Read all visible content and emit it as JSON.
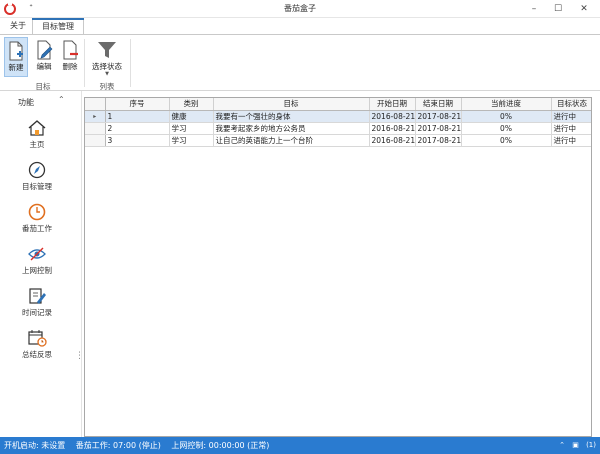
{
  "window": {
    "title": "番茄盒子",
    "quick_access": "ᐩ",
    "minimize": "–",
    "maximize": "☐",
    "close": "✕"
  },
  "ribbon": {
    "tabs": [
      "关于",
      "目标管理"
    ],
    "buttons": {
      "new": "新建",
      "edit": "编辑",
      "delete": "删除",
      "filter": "选择状态"
    },
    "groups": {
      "goal": "目标",
      "list": "列表"
    }
  },
  "nav": {
    "header": "功能",
    "collapse": "⌃",
    "items": [
      {
        "label": "主页",
        "icon": "home-icon"
      },
      {
        "label": "目标管理",
        "icon": "compass-icon"
      },
      {
        "label": "番茄工作",
        "icon": "clock-icon"
      },
      {
        "label": "上网控制",
        "icon": "eye-blocked-icon"
      },
      {
        "label": "时间记录",
        "icon": "notebook-pen-icon"
      },
      {
        "label": "总结反思",
        "icon": "calendar-clock-icon"
      }
    ]
  },
  "grid": {
    "columns": [
      "序号",
      "类别",
      "目标",
      "开始日期",
      "结束日期",
      "当前进度",
      "目标状态"
    ],
    "rows": [
      {
        "indicator": "▸",
        "no": "1",
        "category": "健康",
        "goal": "我要有一个强壮的身体",
        "start": "2016-08-21",
        "end": "2017-08-21",
        "progress": "0%",
        "status": "进行中"
      },
      {
        "indicator": "",
        "no": "2",
        "category": "学习",
        "goal": "我要考起家乡的地方公务员",
        "start": "2016-08-21",
        "end": "2017-08-21",
        "progress": "0%",
        "status": "进行中"
      },
      {
        "indicator": "",
        "no": "3",
        "category": "学习",
        "goal": "让自己的英语能力上一个台阶",
        "start": "2016-08-21",
        "end": "2017-08-21",
        "progress": "0%",
        "status": "进行中"
      }
    ]
  },
  "statusbar": {
    "startup": "开机启动: 未设置",
    "tomato": "番茄工作: 07:00 (停止)",
    "network": "上网控制: 00:00:00 (正常)",
    "tray_count": "(1)"
  },
  "colors": {
    "accent": "#2e72b6",
    "statusbar": "#2a7bd0",
    "selected_row": "#dfe9f5",
    "app_red": "#d9302a"
  }
}
